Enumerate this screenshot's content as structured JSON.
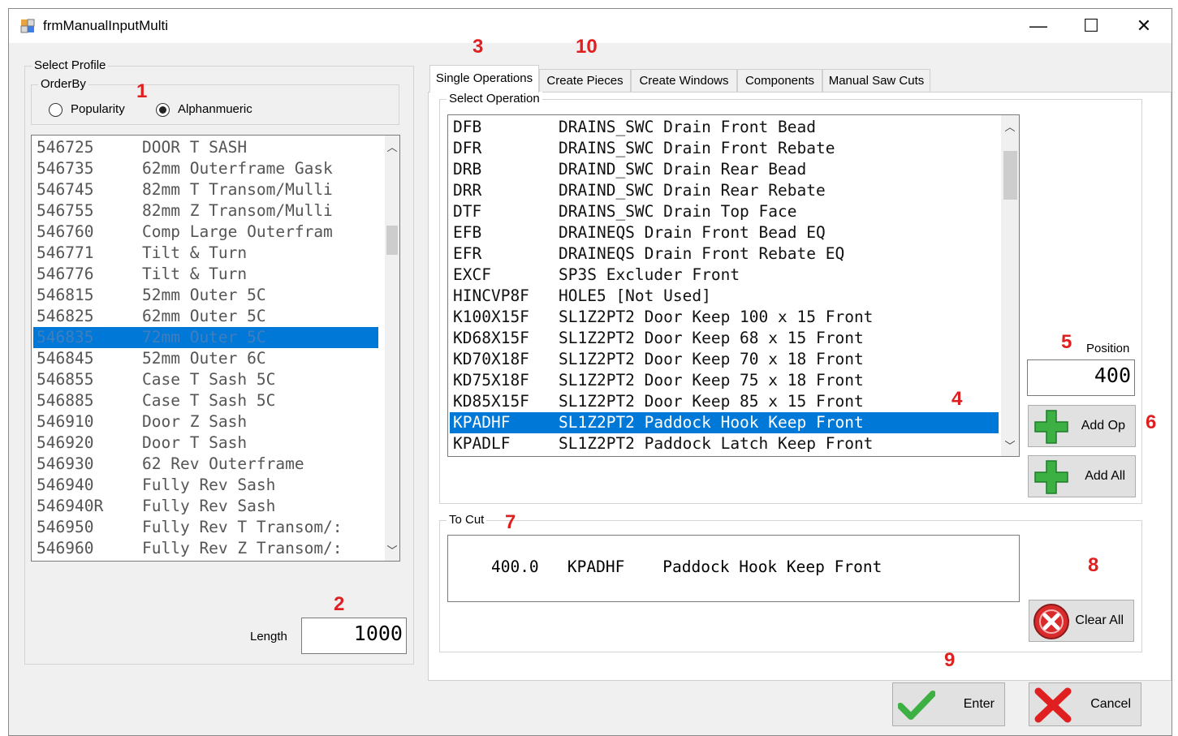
{
  "window": {
    "title": "frmManualInputMulti",
    "minimize": "—",
    "maximize": "☐",
    "close": "✕"
  },
  "profile": {
    "group_label": "Select Profile",
    "orderby_label": "OrderBy",
    "radio_popularity": "Popularity",
    "radio_alpha": "Alphanmueric",
    "selected_order": "Alphanmueric",
    "items": [
      {
        "code": "546725",
        "desc": "DOOR T SASH"
      },
      {
        "code": "546735",
        "desc": "62mm Outerframe Gask"
      },
      {
        "code": "546745",
        "desc": "82mm T Transom/Mulli"
      },
      {
        "code": "546755",
        "desc": "82mm Z Transom/Mulli"
      },
      {
        "code": "546760",
        "desc": "Comp Large Outerfram"
      },
      {
        "code": "546771",
        "desc": "Tilt & Turn"
      },
      {
        "code": "546776",
        "desc": "Tilt & Turn"
      },
      {
        "code": "546815",
        "desc": "52mm Outer 5C"
      },
      {
        "code": "546825",
        "desc": "62mm Outer 5C"
      },
      {
        "code": "546835",
        "desc": "72mm Outer 5C"
      },
      {
        "code": "546845",
        "desc": "52mm Outer 6C"
      },
      {
        "code": "546855",
        "desc": "Case T Sash 5C"
      },
      {
        "code": "546885",
        "desc": "Case T Sash 5C"
      },
      {
        "code": "546910",
        "desc": "Door Z Sash"
      },
      {
        "code": "546920",
        "desc": "Door T Sash"
      },
      {
        "code": "546930",
        "desc": "62 Rev Outerframe"
      },
      {
        "code": "546940",
        "desc": "Fully Rev Sash"
      },
      {
        "code": "546940R",
        "desc": "Fully Rev Sash"
      },
      {
        "code": "546950",
        "desc": "Fully Rev T Transom/:"
      },
      {
        "code": "546960",
        "desc": "Fully Rev Z Transom/:"
      }
    ],
    "selected_code": "546835",
    "length_label": "Length",
    "length_value": "1000"
  },
  "tabs": [
    {
      "label": "Single Operations",
      "active": true
    },
    {
      "label": "Create Pieces",
      "active": false
    },
    {
      "label": "Create Windows",
      "active": false
    },
    {
      "label": "Components",
      "active": false
    },
    {
      "label": "Manual Saw Cuts",
      "active": false
    }
  ],
  "operations": {
    "group_label": "Select Operation",
    "items": [
      {
        "code": "DFB",
        "desc": "DRAINS_SWC Drain Front Bead"
      },
      {
        "code": "DFR",
        "desc": "DRAINS_SWC Drain Front Rebate"
      },
      {
        "code": "DRB",
        "desc": "DRAIND_SWC Drain Rear Bead"
      },
      {
        "code": "DRR",
        "desc": "DRAIND_SWC Drain Rear Rebate"
      },
      {
        "code": "DTF",
        "desc": "DRAINS_SWC Drain Top Face"
      },
      {
        "code": "EFB",
        "desc": "DRAINEQS Drain Front Bead EQ"
      },
      {
        "code": "EFR",
        "desc": "DRAINEQS Drain Front Rebate EQ"
      },
      {
        "code": "EXCF",
        "desc": "SP3S Excluder Front"
      },
      {
        "code": "HINCVP8F",
        "desc": "HOLE5 [Not Used]"
      },
      {
        "code": "K100X15F",
        "desc": "SL1Z2PT2 Door Keep 100 x 15 Front"
      },
      {
        "code": "KD68X15F",
        "desc": "SL1Z2PT2 Door Keep 68 x 15 Front"
      },
      {
        "code": "KD70X18F",
        "desc": "SL1Z2PT2 Door Keep 70 x 18 Front"
      },
      {
        "code": "KD75X18F",
        "desc": "SL1Z2PT2 Door Keep 75 x 18 Front"
      },
      {
        "code": "KD85X15F",
        "desc": "SL1Z2PT2 Door Keep 85 x 15 Front"
      },
      {
        "code": "KPADHF",
        "desc": "SL1Z2PT2 Paddock Hook Keep Front"
      },
      {
        "code": "KPADLF",
        "desc": "SL1Z2PT2 Paddock Latch Keep Front"
      }
    ],
    "selected_code": "KPADHF",
    "position_label": "Position",
    "position_value": "400",
    "add_op_label": "Add Op",
    "add_all_label": "Add All"
  },
  "to_cut": {
    "group_label": "To Cut",
    "line": "400.0   KPADHF    Paddock Hook Keep Front",
    "clear_all_label": "Clear All"
  },
  "footer": {
    "enter_label": "Enter",
    "cancel_label": "Cancel"
  },
  "markers": [
    "1",
    "2",
    "3",
    "4",
    "5",
    "6",
    "7",
    "8",
    "9",
    "10"
  ],
  "colors": {
    "selection": "#0078d7",
    "marker": "#e02020",
    "plus_green": "#3cb043",
    "clear_red": "#d92b2b"
  },
  "icons": {
    "add_op": "green-plus-icon",
    "add_all": "green-plus-icon",
    "clear_all": "red-x-circle-icon",
    "enter": "green-check-icon",
    "cancel": "red-x-icon"
  }
}
